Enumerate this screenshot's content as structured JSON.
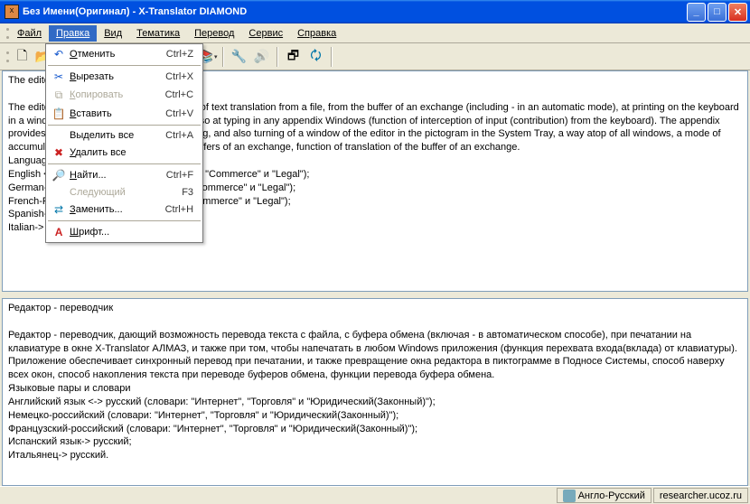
{
  "title": "Без Имени(Оригинал) - X-Translator DIAMOND",
  "menubar": {
    "file": "Файл",
    "edit": "Правка",
    "view": "Вид",
    "theme": "Тематика",
    "translate": "Перевод",
    "service": "Сервис",
    "help": "Справка"
  },
  "edit_menu": {
    "undo": "Отменить",
    "undo_k": "Ctrl+Z",
    "cut": "Вырезать",
    "cut_k": "Ctrl+X",
    "copy": "Копировать",
    "copy_k": "Ctrl+C",
    "paste": "Вставить",
    "paste_k": "Ctrl+V",
    "selectall": "Выделить все",
    "selectall_k": "Ctrl+A",
    "deleteall": "Удалить все",
    "find": "Найти...",
    "find_k": "Ctrl+F",
    "next": "Следующий",
    "next_k": "F3",
    "replace": "Заменить...",
    "replace_k": "Ctrl+H",
    "font": "Шрифт..."
  },
  "pane1": {
    "l1": "The editor - translator",
    "l2": "The editor - translator giving an opportunity of text translation from a file, from the buffer of an exchange (including - in an automatic mode), at printing on the keyboard in a window X-Translator DIAMOND, and also at typing in any appendix Windows (function of interception of input (contribution) from the keyboard). The appendix provides simultaneous interpretation at typing, and also turning of a window of the editor in the pictogram in the System Tray, a way atop of all windows, a mode of accumulation of the text while translating buffers of an exchange, function of translation of the buffer of an exchange.",
    "l3": "Language pairs and dictionaries",
    "l4": "English <-> Russian (dictionaries: \"Internet\", \"Commerce\" и \"Legal\");",
    "l5": "German-Russian (dictionaries: \"Internet\", \"Commerce\" и \"Legal\");",
    "l6": "French-Russian (dictionaries: \"Internet\", \"Commerce\" и \"Legal\");",
    "l7": "Spanish-> Russian;",
    "l8": "Italian-> Russian."
  },
  "pane2": {
    "l1": "Редактор - переводчик",
    "l2": "Редактор - переводчик, дающий возможность перевода текста с файла, с буфера обмена (включая - в автоматическом способе), при печатании на клавиатуре в окне X-Translator АЛМАЗ, и также при том, чтобы напечатать в любом Windows приложения (функция перехвата входа(вклада) от клавиатуры). Приложение обеспечивает синхронный перевод при печатании, и также превращение окна редактора в пиктограмме в Подносе Системы, способ наверху всех окон, способ накопления текста при переводе буферов обмена, функции перевода буфера обмена.",
    "l3": "Языковые пары и словари",
    "l4": "Английский язык <-> русский (словари: \"Интернет\", \"Торговля\" и \"Юридический(Законный)\");",
    "l5": "Немецко-российский (словари: \"Интернет\", \"Торговля\" и \"Юридический(Законный)\");",
    "l6": "Французский-российский (словари: \"Интернет\", \"Торговля\" и \"Юридический(Законный)\");",
    "l7": "Испанский язык-> русский;",
    "l8": "Итальянец-> русский."
  },
  "status": {
    "langpair": "Англо-Русский",
    "site": "researcher.ucoz.ru"
  }
}
